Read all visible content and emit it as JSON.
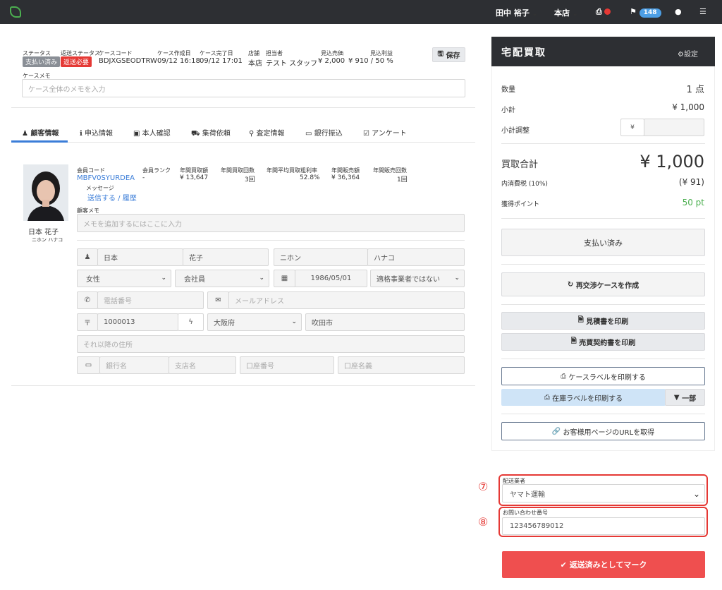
{
  "topbar": {
    "user": "田中 裕子",
    "store": "本店",
    "notification_count": "148"
  },
  "case": {
    "labels": {
      "status": "ステータス",
      "return_status": "返送ステータス",
      "case_code": "ケースコード",
      "created": "ケース作成日",
      "completed": "ケース完了日",
      "store": "店舗",
      "staff": "担当者",
      "expected_sales": "見込売価",
      "expected_profit": "見込利益",
      "memo": "ケースメモ"
    },
    "status": "支払い済み",
    "return_status": "返送必要",
    "case_code": "BDJXGSEODTRW",
    "created": "09/12 16:18",
    "completed": "09/12 17:01",
    "store": "本店",
    "staff": "テスト スタッフ",
    "expected_sales": "¥ 2,000",
    "expected_profit": "¥ 910 / 50 %",
    "memo_placeholder": "ケース全体のメモを入力",
    "save_label": "保存"
  },
  "tabs": [
    {
      "label": "顧客情報",
      "icon": "user-icon"
    },
    {
      "label": "申込情報",
      "icon": "info-icon"
    },
    {
      "label": "本人確認",
      "icon": "id-card-icon"
    },
    {
      "label": "集荷依頼",
      "icon": "truck-icon"
    },
    {
      "label": "査定情報",
      "icon": "search-icon"
    },
    {
      "label": "銀行振込",
      "icon": "money-icon"
    },
    {
      "label": "アンケート",
      "icon": "check-square-icon"
    }
  ],
  "customer": {
    "name": "日本 花子",
    "kana": "ニホン ハナコ",
    "labels": {
      "member_code": "会員コード",
      "rank": "会員ランク",
      "annual_buy_amount": "年間買取額",
      "annual_buy_count": "年間買取回数",
      "avg_margin": "年間平均買取粗利率",
      "annual_sales_amount": "年間販売額",
      "annual_sales_count": "年間販売回数",
      "message": "メッセージ",
      "customer_memo": "顧客メモ"
    },
    "member_code": "MBFV0SYURDEA",
    "rank": "-",
    "annual_buy_amount": "¥ 13,647",
    "annual_buy_count": "3回",
    "avg_margin": "52.8%",
    "annual_sales_amount": "¥ 36,364",
    "annual_sales_count": "1回",
    "message_link": "送信する / 履歴",
    "memo_placeholder": "メモを追加するにはここに入力",
    "last_name": "日本",
    "first_name": "花子",
    "last_name_kana": "ニホン",
    "first_name_kana": "ハナコ",
    "gender": "女性",
    "occupation": "会社員",
    "birthday": "1986/05/01",
    "qualified_invoice": "適格事業者ではない",
    "phone_placeholder": "電話番号",
    "email_placeholder": "メールアドレス",
    "postal_code": "1000013",
    "prefecture": "大阪府",
    "city": "吹田市",
    "address_placeholder": "それ以降の住所",
    "bank_placeholder": "銀行名",
    "branch_placeholder": "支店名",
    "account_number_placeholder": "口座番号",
    "account_name_placeholder": "口座名義"
  },
  "sidebar": {
    "title": "宅配買取",
    "settings_label": "設定",
    "quantity_label": "数量",
    "quantity": "1 点",
    "subtotal_label": "小計",
    "subtotal": "¥ 1,000",
    "adjust_label": "小計調整",
    "adjust_prefix": "¥",
    "total_label": "買取合計",
    "total": "¥ 1,000",
    "tax_label": "内消費税 (10%)",
    "tax": "(¥ 91)",
    "points_label": "獲得ポイント",
    "points": "50 pt",
    "paid_button": "支払い済み",
    "renegotiate_button": "再交渉ケースを作成",
    "print_estimate": "見積書を印刷",
    "print_contract": "売買契約書を印刷",
    "print_case_label": "ケースラベルを印刷する",
    "print_stock_label": "在庫ラベルを印刷する",
    "partial_label": "一部",
    "customer_url": "お客様用ページのURLを取得",
    "carrier_label": "配送業者",
    "carrier": "ヤマト運輸",
    "tracking_label": "お問い合わせ番号",
    "tracking": "123456789012",
    "mark_returned": "返送済みとしてマーク",
    "annotation_7": "⑦",
    "annotation_8": "⑧"
  },
  "colors": {
    "paid_tag": "#8a8f96",
    "return_tag": "#e53935",
    "link": "#3b7dd8",
    "points": "#4caf50",
    "primary_danger": "#ef4f4f",
    "active_tab": "#3b7dd8"
  }
}
